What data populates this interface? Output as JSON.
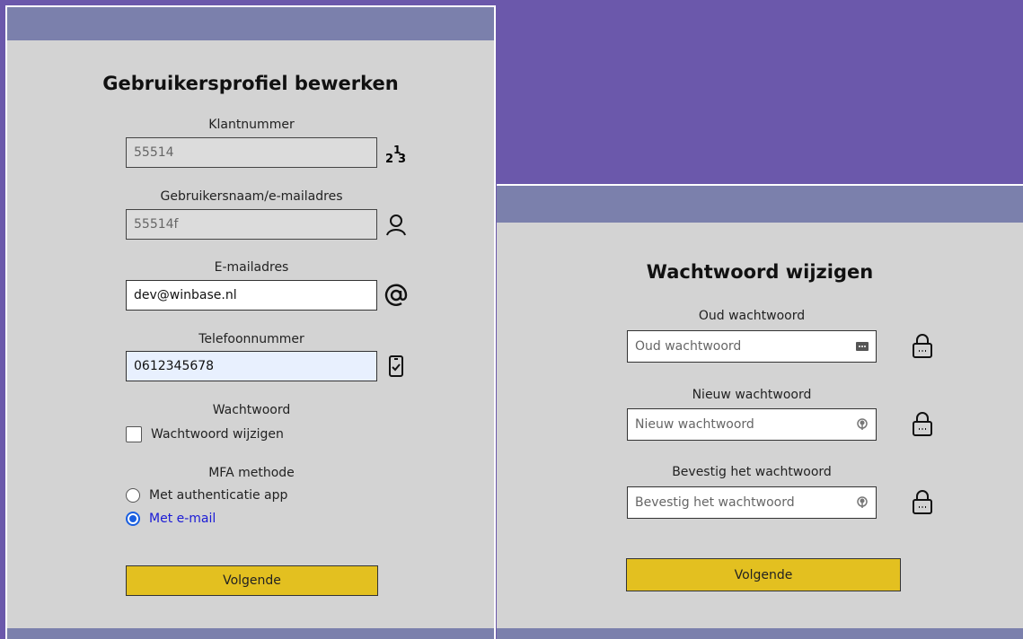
{
  "profile_form": {
    "title": "Gebruikersprofiel bewerken",
    "customer_number": {
      "label": "Klantnummer",
      "value": "55514",
      "icon": "numbers-icon"
    },
    "username": {
      "label": "Gebruikersnaam/e-mailadres",
      "value": "55514f",
      "icon": "user-icon"
    },
    "email": {
      "label": "E-mailadres",
      "value": "dev@winbase.nl",
      "icon": "at-sign-icon"
    },
    "phone": {
      "label": "Telefoonnummer",
      "value": "0612345678",
      "icon": "phone-check-icon"
    },
    "password": {
      "label": "Wachtwoord",
      "checkbox_label": "Wachtwoord wijzigen",
      "checked": false
    },
    "mfa": {
      "label": "MFA methode",
      "options": [
        {
          "label": "Met authenticatie app",
          "selected": false
        },
        {
          "label": "Met e-mail",
          "selected": true
        }
      ]
    },
    "next_button": "Volgende"
  },
  "password_form": {
    "title": "Wachtwoord wijzigen",
    "old_password": {
      "label": "Oud wachtwoord",
      "placeholder": "Oud wachtwoord",
      "icon": "lock-icon"
    },
    "new_password": {
      "label": "Nieuw wachtwoord",
      "placeholder": "Nieuw wachtwoord",
      "icon": "lock-icon"
    },
    "confirm_password": {
      "label": "Bevestig het wachtwoord",
      "placeholder": "Bevestig het wachtwoord",
      "icon": "lock-icon"
    },
    "next_button": "Volgende"
  },
  "colors": {
    "background": "#6b58ab",
    "header_bar": "#7b80ac",
    "panel": "#d3d3d3",
    "button": "#e3c020",
    "radio_accent": "#1a5fe0"
  }
}
